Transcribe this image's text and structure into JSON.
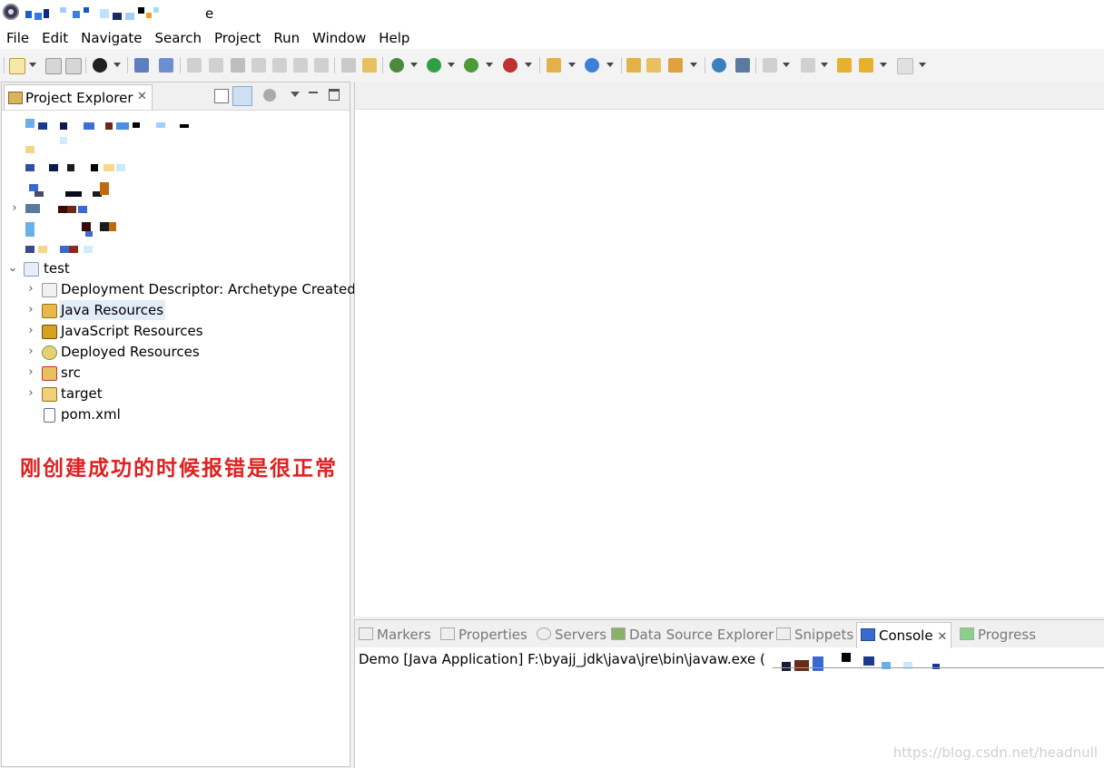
{
  "window": {
    "title_suffix": "e"
  },
  "menu": [
    "File",
    "Edit",
    "Navigate",
    "Search",
    "Project",
    "Run",
    "Window",
    "Help"
  ],
  "project_explorer": {
    "tab_label": "Project Explorer",
    "close_glyph": "✕",
    "project": {
      "name": "test",
      "children": [
        {
          "label": "Deployment Descriptor: Archetype Created",
          "icon": "deployment-descriptor-icon"
        },
        {
          "label": "Java Resources",
          "icon": "java-resources-icon",
          "selected": true
        },
        {
          "label": "JavaScript Resources",
          "icon": "javascript-resources-icon"
        },
        {
          "label": "Deployed Resources",
          "icon": "deployed-resources-icon"
        },
        {
          "label": "src",
          "icon": "folder-error-icon"
        },
        {
          "label": "target",
          "icon": "folder-icon"
        },
        {
          "label": "pom.xml",
          "icon": "maven-file-icon"
        }
      ]
    },
    "annotation": "刚创建成功的时候报错是很正常"
  },
  "bottom_panel": {
    "tabs": [
      "Markers",
      "Properties",
      "Servers",
      "Data Source Explorer",
      "Snippets",
      "Console",
      "Progress"
    ],
    "active_tab": "Console",
    "close_glyph": "✕",
    "console_line": "Demo [Java Application] F:\\byajj_jdk\\java\\jre\\bin\\javaw.exe ("
  },
  "watermark": "https://blog.csdn.net/headnull",
  "colors": {
    "accent": "#e02020",
    "selection": "#e3edf8"
  }
}
